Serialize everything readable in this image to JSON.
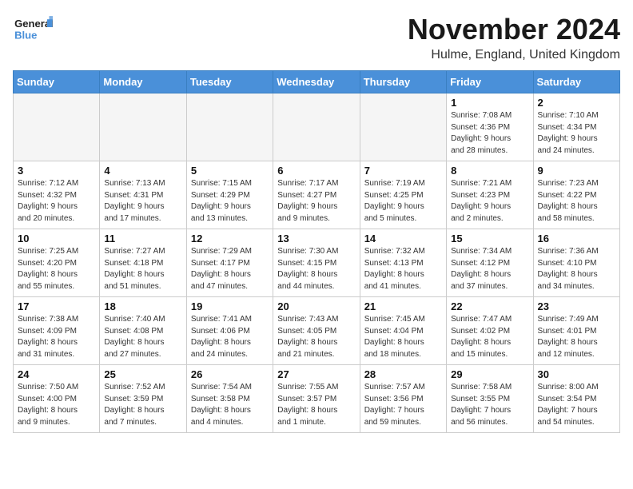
{
  "header": {
    "logo_text_general": "General",
    "logo_text_blue": "Blue",
    "month_title": "November 2024",
    "location": "Hulme, England, United Kingdom"
  },
  "weekdays": [
    "Sunday",
    "Monday",
    "Tuesday",
    "Wednesday",
    "Thursday",
    "Friday",
    "Saturday"
  ],
  "weeks": [
    [
      {
        "day": "",
        "info": ""
      },
      {
        "day": "",
        "info": ""
      },
      {
        "day": "",
        "info": ""
      },
      {
        "day": "",
        "info": ""
      },
      {
        "day": "",
        "info": ""
      },
      {
        "day": "1",
        "info": "Sunrise: 7:08 AM\nSunset: 4:36 PM\nDaylight: 9 hours\nand 28 minutes."
      },
      {
        "day": "2",
        "info": "Sunrise: 7:10 AM\nSunset: 4:34 PM\nDaylight: 9 hours\nand 24 minutes."
      }
    ],
    [
      {
        "day": "3",
        "info": "Sunrise: 7:12 AM\nSunset: 4:32 PM\nDaylight: 9 hours\nand 20 minutes."
      },
      {
        "day": "4",
        "info": "Sunrise: 7:13 AM\nSunset: 4:31 PM\nDaylight: 9 hours\nand 17 minutes."
      },
      {
        "day": "5",
        "info": "Sunrise: 7:15 AM\nSunset: 4:29 PM\nDaylight: 9 hours\nand 13 minutes."
      },
      {
        "day": "6",
        "info": "Sunrise: 7:17 AM\nSunset: 4:27 PM\nDaylight: 9 hours\nand 9 minutes."
      },
      {
        "day": "7",
        "info": "Sunrise: 7:19 AM\nSunset: 4:25 PM\nDaylight: 9 hours\nand 5 minutes."
      },
      {
        "day": "8",
        "info": "Sunrise: 7:21 AM\nSunset: 4:23 PM\nDaylight: 9 hours\nand 2 minutes."
      },
      {
        "day": "9",
        "info": "Sunrise: 7:23 AM\nSunset: 4:22 PM\nDaylight: 8 hours\nand 58 minutes."
      }
    ],
    [
      {
        "day": "10",
        "info": "Sunrise: 7:25 AM\nSunset: 4:20 PM\nDaylight: 8 hours\nand 55 minutes."
      },
      {
        "day": "11",
        "info": "Sunrise: 7:27 AM\nSunset: 4:18 PM\nDaylight: 8 hours\nand 51 minutes."
      },
      {
        "day": "12",
        "info": "Sunrise: 7:29 AM\nSunset: 4:17 PM\nDaylight: 8 hours\nand 47 minutes."
      },
      {
        "day": "13",
        "info": "Sunrise: 7:30 AM\nSunset: 4:15 PM\nDaylight: 8 hours\nand 44 minutes."
      },
      {
        "day": "14",
        "info": "Sunrise: 7:32 AM\nSunset: 4:13 PM\nDaylight: 8 hours\nand 41 minutes."
      },
      {
        "day": "15",
        "info": "Sunrise: 7:34 AM\nSunset: 4:12 PM\nDaylight: 8 hours\nand 37 minutes."
      },
      {
        "day": "16",
        "info": "Sunrise: 7:36 AM\nSunset: 4:10 PM\nDaylight: 8 hours\nand 34 minutes."
      }
    ],
    [
      {
        "day": "17",
        "info": "Sunrise: 7:38 AM\nSunset: 4:09 PM\nDaylight: 8 hours\nand 31 minutes."
      },
      {
        "day": "18",
        "info": "Sunrise: 7:40 AM\nSunset: 4:08 PM\nDaylight: 8 hours\nand 27 minutes."
      },
      {
        "day": "19",
        "info": "Sunrise: 7:41 AM\nSunset: 4:06 PM\nDaylight: 8 hours\nand 24 minutes."
      },
      {
        "day": "20",
        "info": "Sunrise: 7:43 AM\nSunset: 4:05 PM\nDaylight: 8 hours\nand 21 minutes."
      },
      {
        "day": "21",
        "info": "Sunrise: 7:45 AM\nSunset: 4:04 PM\nDaylight: 8 hours\nand 18 minutes."
      },
      {
        "day": "22",
        "info": "Sunrise: 7:47 AM\nSunset: 4:02 PM\nDaylight: 8 hours\nand 15 minutes."
      },
      {
        "day": "23",
        "info": "Sunrise: 7:49 AM\nSunset: 4:01 PM\nDaylight: 8 hours\nand 12 minutes."
      }
    ],
    [
      {
        "day": "24",
        "info": "Sunrise: 7:50 AM\nSunset: 4:00 PM\nDaylight: 8 hours\nand 9 minutes."
      },
      {
        "day": "25",
        "info": "Sunrise: 7:52 AM\nSunset: 3:59 PM\nDaylight: 8 hours\nand 7 minutes."
      },
      {
        "day": "26",
        "info": "Sunrise: 7:54 AM\nSunset: 3:58 PM\nDaylight: 8 hours\nand 4 minutes."
      },
      {
        "day": "27",
        "info": "Sunrise: 7:55 AM\nSunset: 3:57 PM\nDaylight: 8 hours\nand 1 minute."
      },
      {
        "day": "28",
        "info": "Sunrise: 7:57 AM\nSunset: 3:56 PM\nDaylight: 7 hours\nand 59 minutes."
      },
      {
        "day": "29",
        "info": "Sunrise: 7:58 AM\nSunset: 3:55 PM\nDaylight: 7 hours\nand 56 minutes."
      },
      {
        "day": "30",
        "info": "Sunrise: 8:00 AM\nSunset: 3:54 PM\nDaylight: 7 hours\nand 54 minutes."
      }
    ]
  ]
}
